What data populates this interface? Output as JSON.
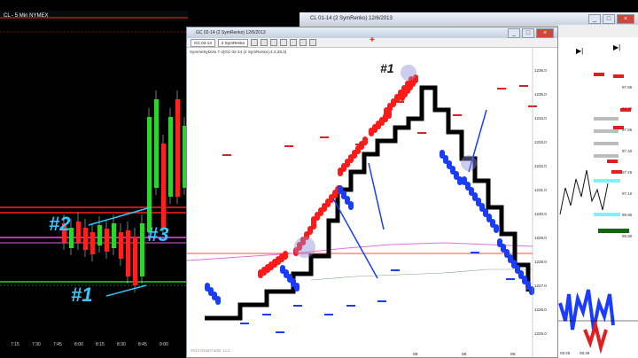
{
  "left_window": {
    "title": "CL - 5 Min  NYMEX",
    "time_labels": [
      "7:15",
      "7:30",
      "7:45",
      "8:00",
      "8:15",
      "8:30",
      "8:45",
      "9:00"
    ],
    "annotations": [
      "#2",
      "#3",
      "#1"
    ]
  },
  "right_window": {
    "title": "CL 01-14 (2 SymRenko) 12/6/2013",
    "side_labels": [
      "97.85",
      "97.70",
      "97.55",
      "97.40",
      "97.25",
      "97.10",
      "96.95",
      "96.80"
    ],
    "time_labels": [
      "08:29",
      "08:48"
    ]
  },
  "main_window": {
    "title": "GC 02-14 (2 SymRenko) 12/6/2013",
    "toolbar": {
      "instrument": "GC 02-14",
      "bar_type": "2 SymRenko"
    },
    "indicator_label": "SymmetryDots 7.4(GC 02-14 (2 SymRenko),4.2,28,3)",
    "annotation": "#1",
    "price_labels": [
      "1236.0",
      "1235.0",
      "1234.0",
      "1233.0",
      "1232.0",
      "1231.0",
      "1230.0",
      "1229.0",
      "1228.0",
      "1227.0",
      "1226.0",
      "1225.0"
    ],
    "time_labels": [
      "08:",
      "08:",
      "08:"
    ],
    "watermark": "2013 NinjaTrader, LLC",
    "window_buttons": [
      "_",
      "□",
      "×"
    ]
  },
  "colors": {
    "brick_up": "#ff1a1a",
    "brick_down": "#1a3cff",
    "step_line": "#000000",
    "annotation_blue": "#35c7ff",
    "left_up": "#2bd62b",
    "left_down": "#ff2020",
    "highlight": "#8f8fd6"
  },
  "icons": [
    "minimize-icon",
    "maximize-icon",
    "close-icon",
    "chart-cursor-icon"
  ]
}
